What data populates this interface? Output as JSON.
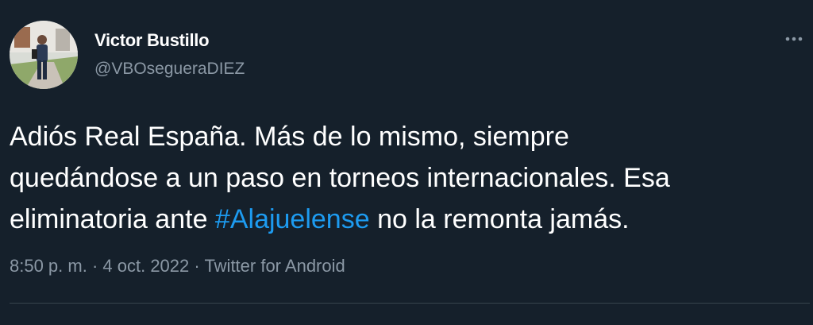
{
  "author": {
    "display_name": "Victor Bustillo",
    "handle": "@VBOsegueraDIEZ"
  },
  "more_icon": "more-horizontal-icon",
  "tweet": {
    "line1": "Adiós Real España. Más de lo mismo, siempre",
    "line2": "quedándose a un paso en torneos internacionales. Esa",
    "line3_before": "eliminatoria ante ",
    "hashtag": "#Alajuelense",
    "line3_after": " no la remonta jamás."
  },
  "meta": {
    "time": "8:50 p. m.",
    "sep1": " · ",
    "date": "4 oct. 2022",
    "sep2": " · ",
    "source": "Twitter for Android"
  },
  "colors": {
    "background": "#15202b",
    "text": "#ffffff",
    "secondary": "#8b98a5",
    "link": "#1d9bf0",
    "divider": "#38444d"
  }
}
